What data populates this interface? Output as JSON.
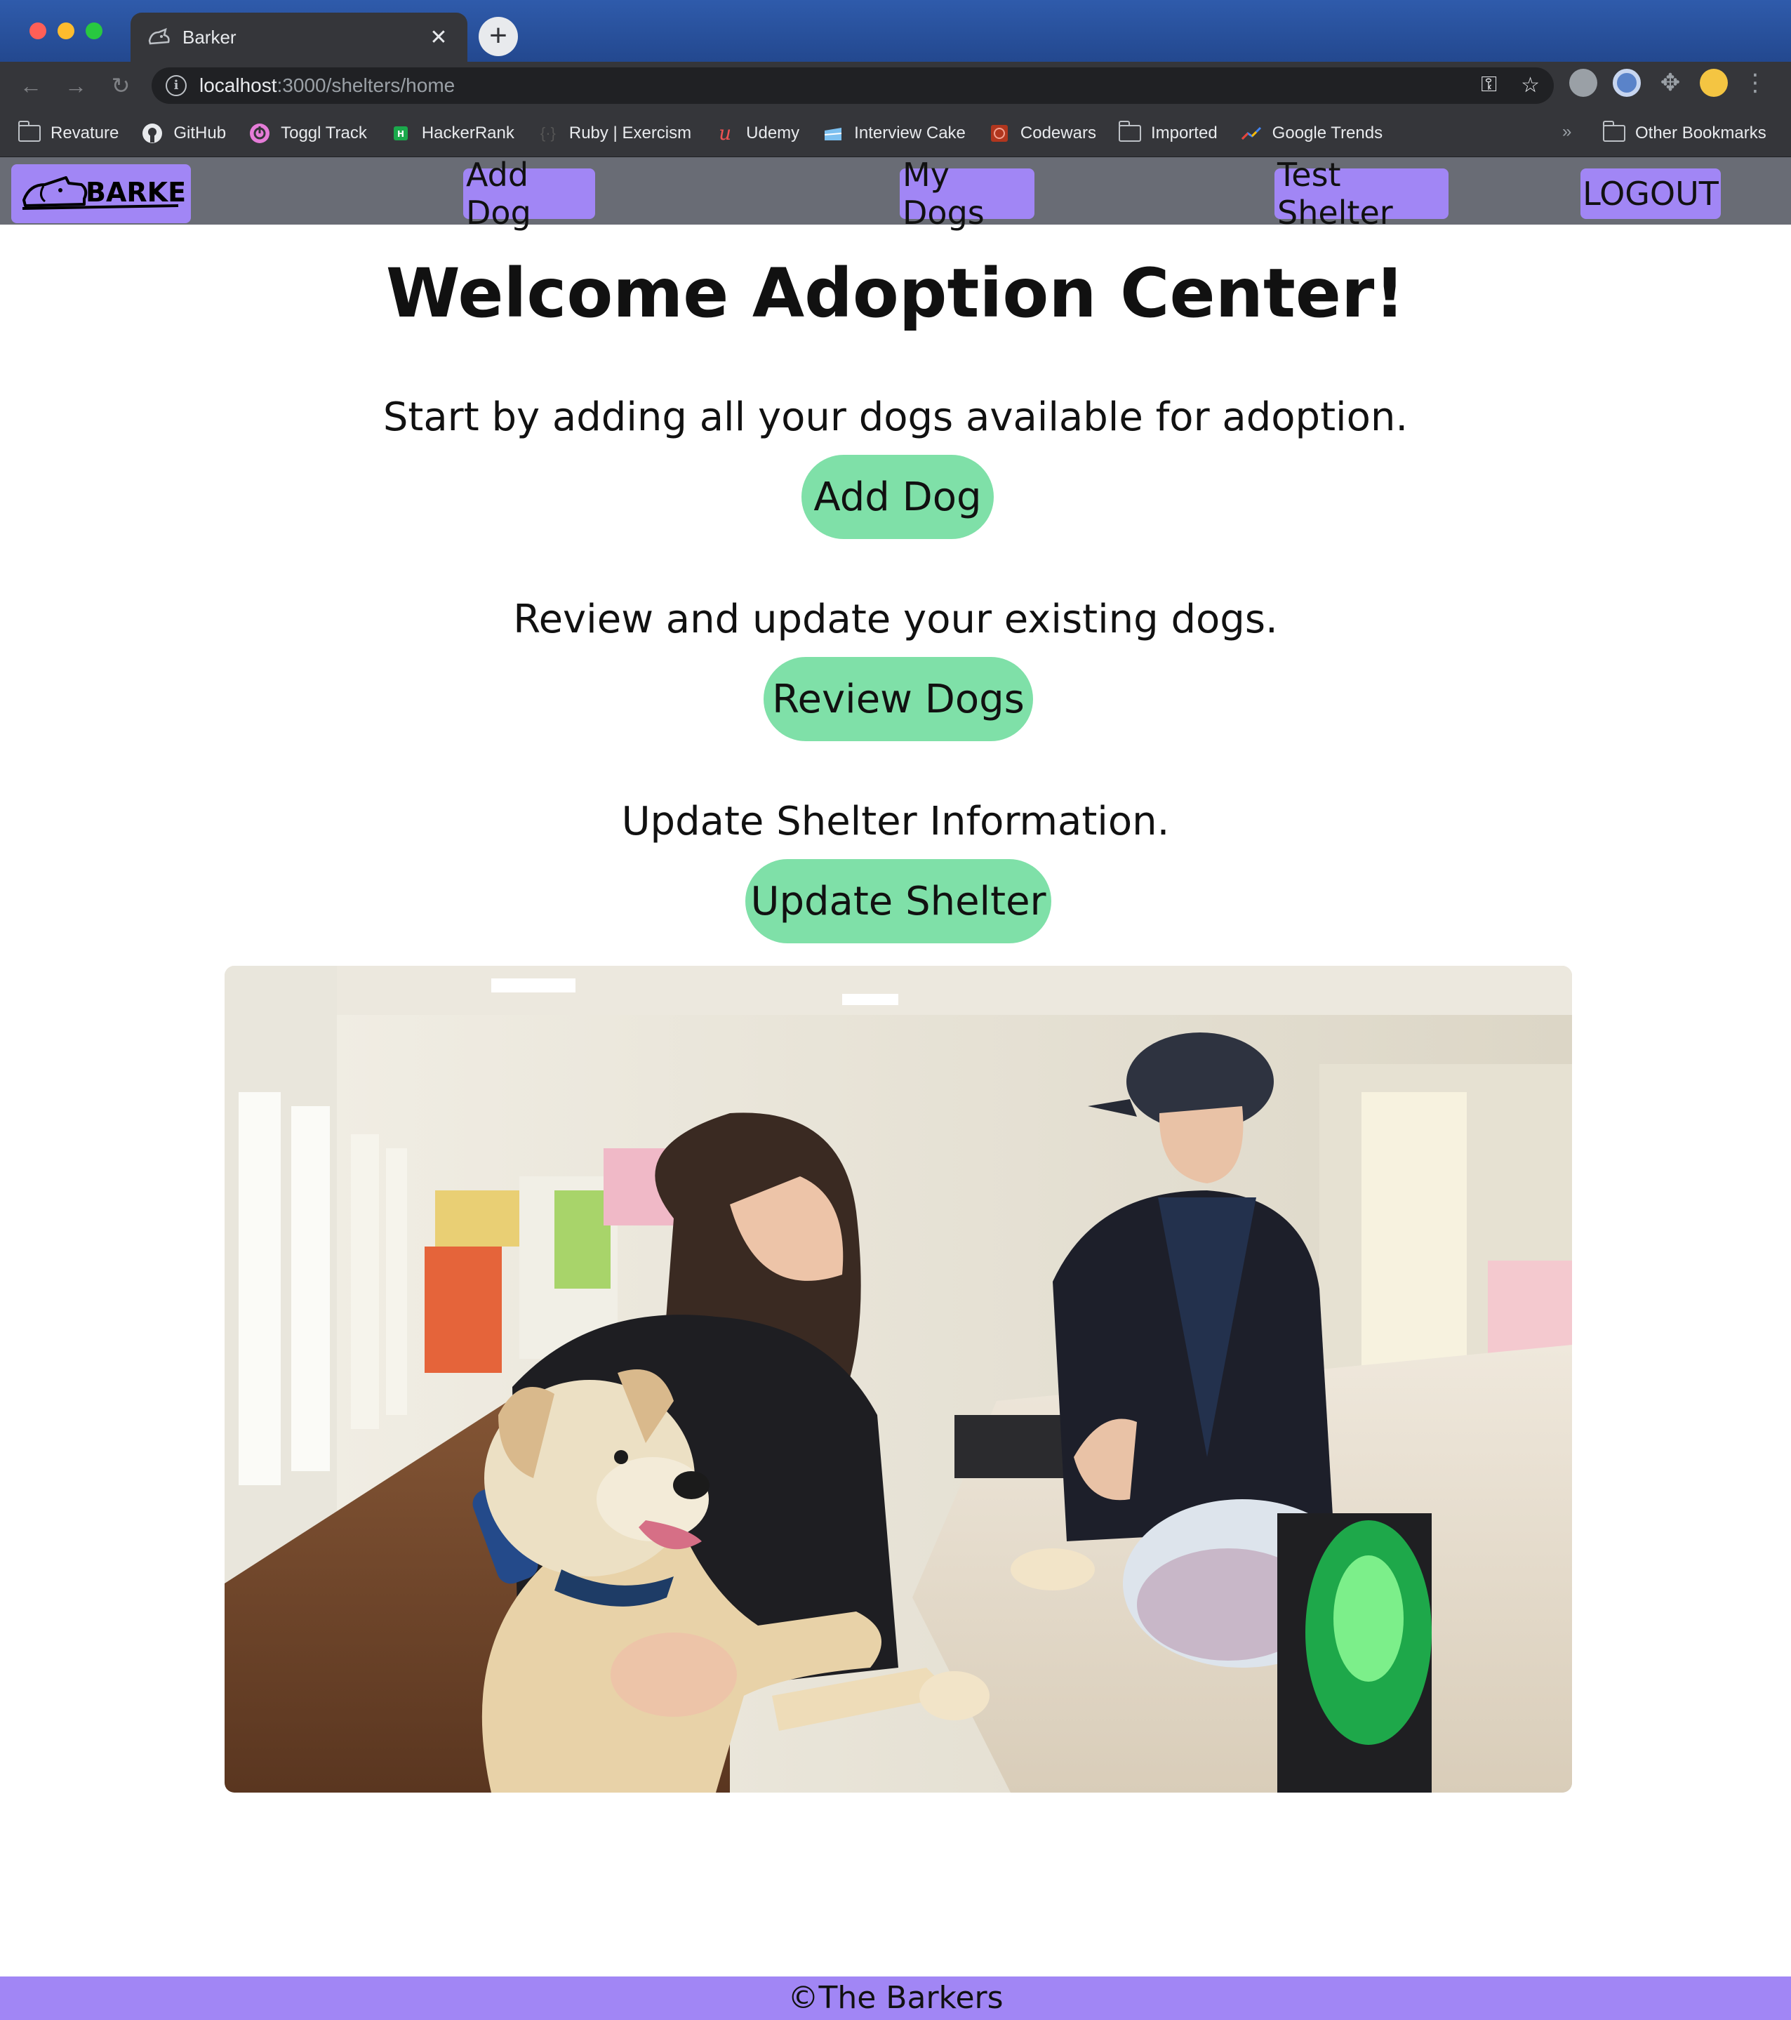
{
  "browser": {
    "tab_title": "Barker",
    "url_host": "localhost",
    "url_path": ":3000/shelters/home",
    "bookmarks": [
      {
        "label": "Revature",
        "icon": "folder-icon"
      },
      {
        "label": "GitHub",
        "icon": "github-icon"
      },
      {
        "label": "Toggl Track",
        "icon": "toggl-icon"
      },
      {
        "label": "HackerRank",
        "icon": "hackerrank-icon"
      },
      {
        "label": "Ruby | Exercism",
        "icon": "exercism-icon"
      },
      {
        "label": "Udemy",
        "icon": "udemy-icon"
      },
      {
        "label": "Interview Cake",
        "icon": "interview-cake-icon"
      },
      {
        "label": "Codewars",
        "icon": "codewars-icon"
      },
      {
        "label": "Imported",
        "icon": "folder-icon"
      },
      {
        "label": "Google Trends",
        "icon": "google-trends-icon"
      }
    ],
    "overflow": "»",
    "other_bookmarks": "Other Bookmarks"
  },
  "nav": {
    "logo_text": "BARKER",
    "links": [
      "Add Dog",
      "My Dogs",
      "Test Shelter",
      "LOGOUT"
    ]
  },
  "main": {
    "title": "Welcome Adoption Center!",
    "sections": [
      {
        "prompt": "Start by adding all your dogs available for adoption.",
        "button": "Add Dog"
      },
      {
        "prompt": "Review and update your existing dogs.",
        "button": "Review Dogs"
      },
      {
        "prompt": "Update Shelter Information.",
        "button": "Update Shelter"
      }
    ]
  },
  "footer": {
    "text": "©The Barkers"
  },
  "colors": {
    "nav_bg": "#696c75",
    "accent_purple": "#a186f5",
    "button_green": "#7fe0a8"
  }
}
